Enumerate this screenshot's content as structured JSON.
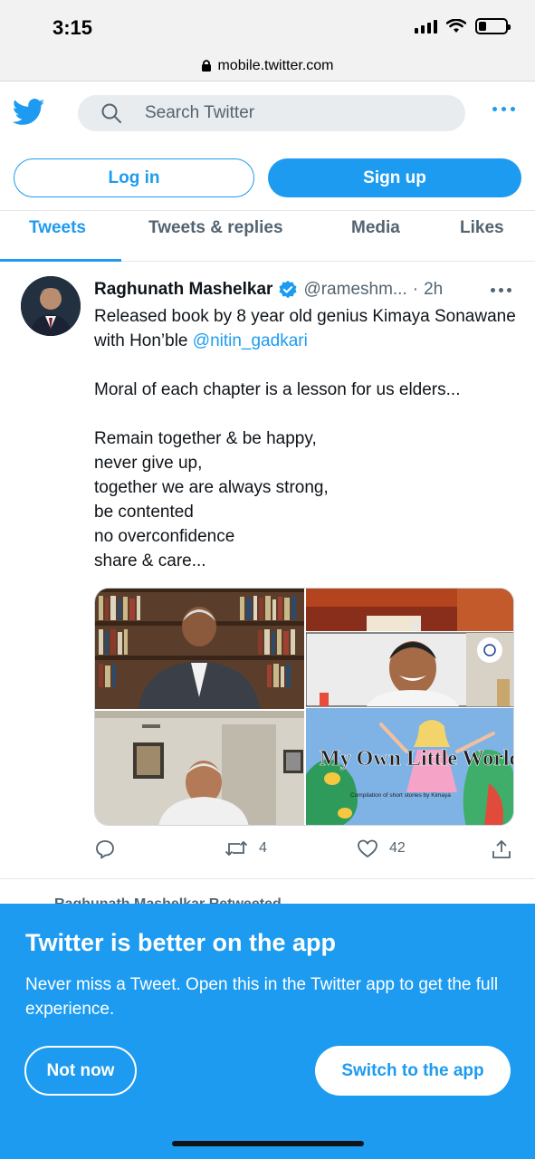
{
  "status_bar": {
    "time": "3:15"
  },
  "browser": {
    "url": "mobile.twitter.com"
  },
  "header": {
    "search_placeholder": "Search Twitter"
  },
  "auth": {
    "login_label": "Log in",
    "signup_label": "Sign up"
  },
  "tabs": [
    {
      "label": "Tweets",
      "active": true
    },
    {
      "label": "Tweets & replies",
      "active": false
    },
    {
      "label": "Media",
      "active": false
    },
    {
      "label": "Likes",
      "active": false
    }
  ],
  "tweet": {
    "author_name": "Raghunath Mashelkar",
    "handle": "@rameshm...",
    "separator": "·",
    "time": "2h",
    "text_intro": "Released book by 8 year old genius Kimaya Sonawane with Hon’ble ",
    "mention": "@nitin_gadkari",
    "text_body": "Moral of each chapter is a lesson for us elders...\n\nRemain together & be happy,\nnever give up,\ntogether we are always strong,\nbe contented\nno overconfidence\nshare & care...",
    "book_cover_text": "My Own Little World.",
    "book_cover_subtitle": "Compilation of short stories by Kimaya",
    "retweet_count": "4",
    "like_count": "42"
  },
  "next_item": {
    "retweeted_text": "Raghunath Mashelkar Retweeted"
  },
  "app_banner": {
    "title": "Twitter is better on the app",
    "text": "Never miss a Tweet. Open this in the Twitter app to get the full experience.",
    "not_now_label": "Not now",
    "switch_label": "Switch to the app"
  },
  "colors": {
    "accent": "#1d9bf0",
    "text": "#0f1419",
    "secondary": "#536471"
  }
}
